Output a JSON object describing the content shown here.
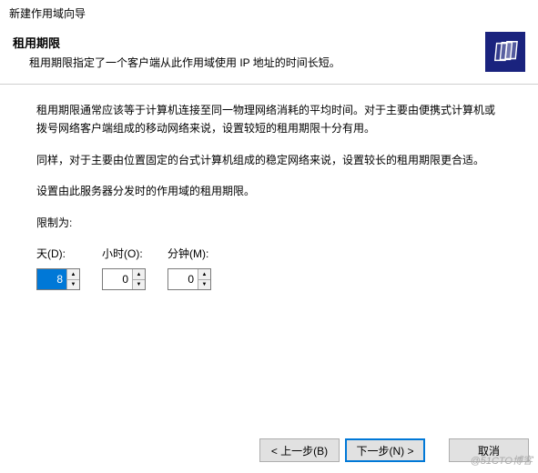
{
  "window": {
    "title": "新建作用域向导"
  },
  "header": {
    "title": "租用期限",
    "subtitle": "租用期限指定了一个客户端从此作用域使用 IP 地址的时间长短。"
  },
  "body": {
    "p1": "租用期限通常应该等于计算机连接至同一物理网络消耗的平均时间。对于主要由便携式计算机或拨号网络客户端组成的移动网络来说，设置较短的租用期限十分有用。",
    "p2": "同样，对于主要由位置固定的台式计算机组成的稳定网络来说，设置较长的租用期限更合适。",
    "p3": "设置由此服务器分发时的作用域的租用期限。",
    "limit_label": "限制为:"
  },
  "inputs": {
    "days": {
      "label": "天(D):",
      "value": "8"
    },
    "hours": {
      "label": "小时(O):",
      "value": "0"
    },
    "minutes": {
      "label": "分钟(M):",
      "value": "0"
    }
  },
  "buttons": {
    "back": "< 上一步(B)",
    "next": "下一步(N) >",
    "cancel": "取消"
  },
  "watermark": "@51CTO博客"
}
